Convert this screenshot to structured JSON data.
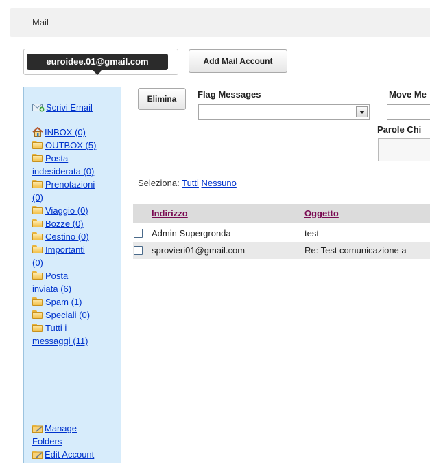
{
  "header": {
    "title": "Mail"
  },
  "account": {
    "email": "euroidee.01@gmail.com",
    "add_label": "Add Mail Account"
  },
  "sidebar": {
    "compose": "Scrivi Email",
    "folders": [
      {
        "label": "INBOX (0)",
        "icon": "home-icon"
      },
      {
        "label": "OUTBOX (5)",
        "icon": "folder-icon"
      },
      {
        "label_line1": "Posta",
        "label_line2": "indesiderata (0)",
        "icon": "folder-icon"
      },
      {
        "label_line1": "Prenotazioni",
        "label_line2": "(0)",
        "icon": "folder-icon"
      },
      {
        "label": "Viaggio (0)",
        "icon": "folder-icon"
      },
      {
        "label": "Bozze (0)",
        "icon": "folder-icon"
      },
      {
        "label": "Cestino (0)",
        "icon": "folder-icon"
      },
      {
        "label_line1": "Importanti",
        "label_line2": "(0)",
        "icon": "folder-icon"
      },
      {
        "label_line1": "Posta",
        "label_line2": "inviata (6)",
        "icon": "folder-icon"
      },
      {
        "label": "Spam (1)",
        "icon": "folder-icon"
      },
      {
        "label": "Speciali (0)",
        "icon": "folder-icon"
      },
      {
        "label_line1": "Tutti i",
        "label_line2": "messaggi (11)",
        "icon": "folder-icon"
      }
    ],
    "manage_line1": "Manage",
    "manage_line2": "Folders",
    "edit_account": "Edit Account"
  },
  "toolbar": {
    "delete_label": "Elimina",
    "flag_label": "Flag Messages",
    "move_label": "Move Me",
    "keywords_label": "Parole Chi"
  },
  "selection": {
    "prefix": "Seleziona:",
    "all": "Tutti",
    "none": "Nessuno"
  },
  "table": {
    "columns": [
      "Indirizzo",
      "Oggetto"
    ],
    "rows": [
      {
        "from": "Admin Supergronda",
        "subject": "test"
      },
      {
        "from": "sprovieri01@gmail.com",
        "subject": "Re: Test comunicazione a"
      }
    ]
  },
  "colors": {
    "sidebar_bg": "#d7ecfb",
    "link": "#0033cc",
    "header_link": "#7a0a52",
    "account_pill": "#2b2b2b"
  }
}
